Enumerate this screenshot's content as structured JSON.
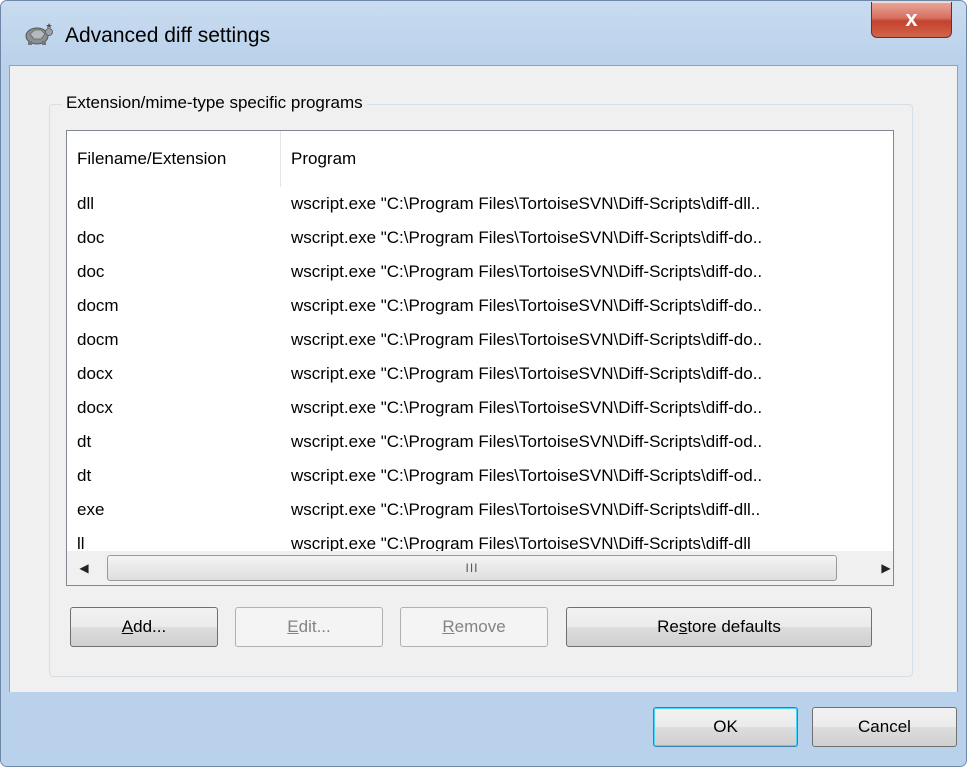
{
  "window": {
    "title": "Advanced diff settings",
    "close_label": "x"
  },
  "group": {
    "title": "Extension/mime-type specific programs"
  },
  "list": {
    "columns": [
      "Filename/Extension",
      "Program"
    ],
    "rows": [
      {
        "ext": "dll",
        "program": "wscript.exe \"C:\\Program Files\\TortoiseSVN\\Diff-Scripts\\diff-dll.."
      },
      {
        "ext": "doc",
        "program": "wscript.exe \"C:\\Program Files\\TortoiseSVN\\Diff-Scripts\\diff-do.."
      },
      {
        "ext": "doc",
        "program": "wscript.exe \"C:\\Program Files\\TortoiseSVN\\Diff-Scripts\\diff-do.."
      },
      {
        "ext": "docm",
        "program": "wscript.exe \"C:\\Program Files\\TortoiseSVN\\Diff-Scripts\\diff-do.."
      },
      {
        "ext": "docm",
        "program": "wscript.exe \"C:\\Program Files\\TortoiseSVN\\Diff-Scripts\\diff-do.."
      },
      {
        "ext": "docx",
        "program": "wscript.exe \"C:\\Program Files\\TortoiseSVN\\Diff-Scripts\\diff-do.."
      },
      {
        "ext": "docx",
        "program": "wscript.exe \"C:\\Program Files\\TortoiseSVN\\Diff-Scripts\\diff-do.."
      },
      {
        "ext": "dt",
        "program": "wscript.exe \"C:\\Program Files\\TortoiseSVN\\Diff-Scripts\\diff-od.."
      },
      {
        "ext": "dt",
        "program": "wscript.exe \"C:\\Program Files\\TortoiseSVN\\Diff-Scripts\\diff-od.."
      },
      {
        "ext": "exe",
        "program": "wscript.exe \"C:\\Program Files\\TortoiseSVN\\Diff-Scripts\\diff-dll.."
      },
      {
        "ext": "ll",
        "program": "wscript.exe \"C:\\Program Files\\TortoiseSVN\\Diff-Scripts\\diff-dll"
      }
    ],
    "hscroll_grip": "III",
    "vscroll_grip": "≡"
  },
  "buttons": {
    "add": {
      "mnemonic": "A",
      "rest": "dd..."
    },
    "edit": {
      "mnemonic": "E",
      "rest": "dit..."
    },
    "remove": {
      "mnemonic": "R",
      "rest": "emove"
    },
    "restore": {
      "pre": "Re",
      "mnemonic": "s",
      "rest": "tore defaults"
    },
    "ok": "OK",
    "cancel": "Cancel"
  }
}
